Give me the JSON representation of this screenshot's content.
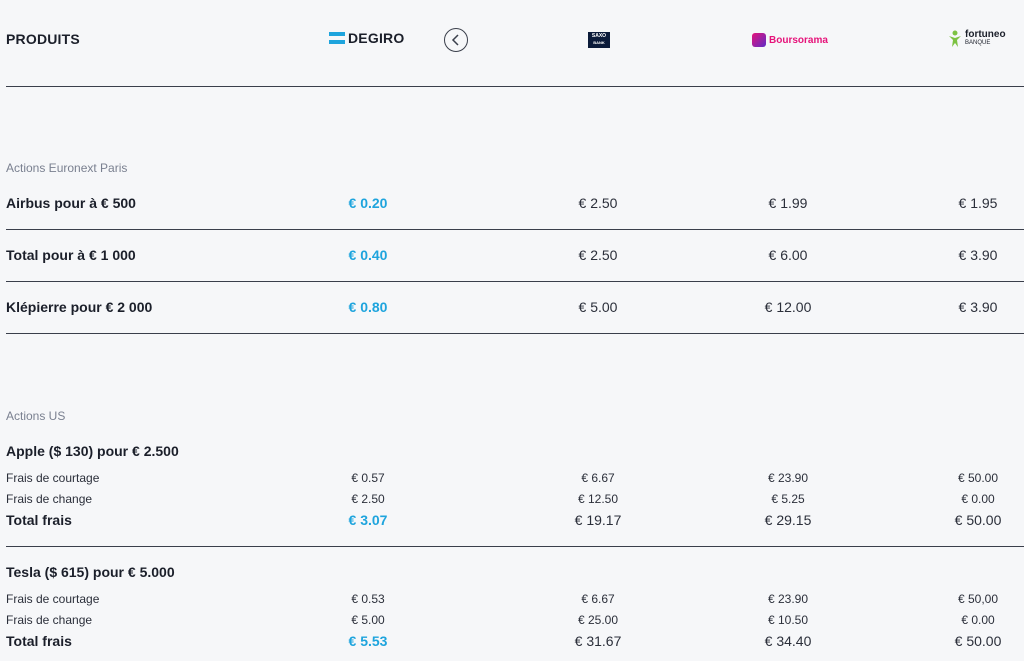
{
  "header": {
    "title": "PRODUITS",
    "brokers": [
      "DEGIRO",
      "SAXO BANK",
      "Boursorama",
      "fortuneo",
      "BANQUE"
    ]
  },
  "colors": {
    "accent": "#1ea4dd",
    "bourso": "#e6137a",
    "fortuneo": "#7cc242",
    "saxo": "#0b1b3a"
  },
  "sections": {
    "euronext": {
      "label": "Actions Euronext Paris",
      "rows": [
        {
          "label": "Airbus pour à € 500",
          "degiro": "€ 0.20",
          "saxo": "€ 2.50",
          "bourso": "€ 1.99",
          "fortuneo": "€ 1.95"
        },
        {
          "label": "Total pour à € 1 000",
          "degiro": "€ 0.40",
          "saxo": "€ 2.50",
          "bourso": "€ 6.00",
          "fortuneo": "€ 3.90"
        },
        {
          "label": "Klépierre pour € 2 000",
          "degiro": "€ 0.80",
          "saxo": "€ 5.00",
          "bourso": "€ 12.00",
          "fortuneo": "€ 3.90"
        }
      ]
    },
    "us": {
      "label": "Actions US",
      "groups": [
        {
          "title": "Apple ($ 130) pour € 2.500",
          "lines": [
            {
              "label": "Frais de courtage",
              "degiro": "€ 0.57",
              "saxo": "€ 6.67",
              "bourso": "€ 23.90",
              "fortuneo": "€ 50.00"
            },
            {
              "label": "Frais de change",
              "degiro": "€ 2.50",
              "saxo": "€ 12.50",
              "bourso": "€ 5.25",
              "fortuneo": "€ 0.00"
            }
          ],
          "total": {
            "label": "Total frais",
            "degiro": "€ 3.07",
            "saxo": "€ 19.17",
            "bourso": "€ 29.15",
            "fortuneo": "€ 50.00"
          }
        },
        {
          "title": "Tesla ($ 615) pour € 5.000",
          "lines": [
            {
              "label": "Frais de courtage",
              "degiro": "€ 0.53",
              "saxo": "€ 6.67",
              "bourso": "€ 23.90",
              "fortuneo": "€ 50,00"
            },
            {
              "label": "Frais de change",
              "degiro": "€ 5.00",
              "saxo": "€ 25.00",
              "bourso": "€ 10.50",
              "fortuneo": "€ 0.00"
            }
          ],
          "total": {
            "label": "Total frais",
            "degiro": "€ 5.53",
            "saxo": "€ 31.67",
            "bourso": "€ 34.40",
            "fortuneo": "€ 50.00"
          }
        }
      ]
    }
  }
}
